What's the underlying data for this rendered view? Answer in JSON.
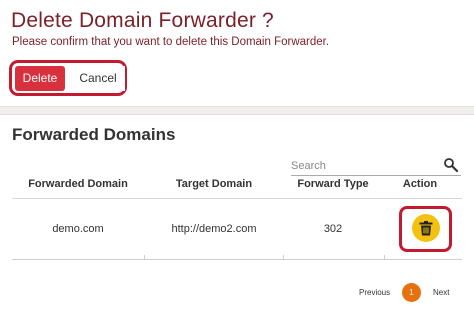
{
  "confirm": {
    "title": "Delete Domain Forwarder ?",
    "message": "Please confirm that you want to delete this Domain Forwarder.",
    "delete_label": "Delete",
    "cancel_label": "Cancel"
  },
  "list": {
    "title": "Forwarded Domains",
    "search_placeholder": "Search",
    "columns": [
      "Forwarded Domain",
      "Target Domain",
      "Forward Type",
      "Action"
    ],
    "rows": [
      {
        "forwarded_domain": "demo.com",
        "target_domain": "http://demo2.com",
        "forward_type": "302",
        "action_icon": "trash-icon"
      }
    ]
  },
  "pagination": {
    "previous_label": "Previous",
    "current_page": "1",
    "next_label": "Next"
  },
  "colors": {
    "title": "#7b1f28",
    "delete_button": "#d9303e",
    "highlight": "#c4192e",
    "trash_button": "#f3c110",
    "current_page": "#e8710f"
  }
}
